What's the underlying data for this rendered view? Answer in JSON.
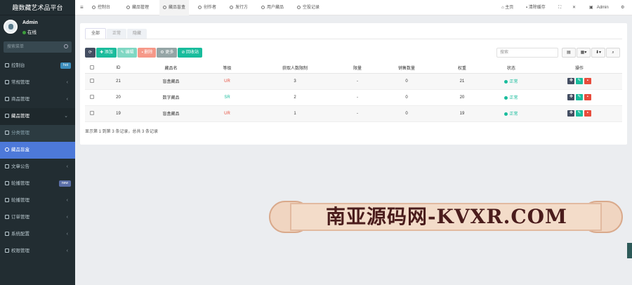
{
  "app": {
    "title": "趣数藏艺术品平台"
  },
  "user": {
    "name": "Admin",
    "status": "在线"
  },
  "sidebar": {
    "search_placeholder": "搜索菜单",
    "items": [
      {
        "label": "控制台",
        "badge": "hot",
        "badge_color": "#3c8dbc"
      },
      {
        "label": "常规管理"
      },
      {
        "label": "商品管理"
      },
      {
        "label": "藏品管理",
        "open": true
      },
      {
        "label": "文章公告"
      },
      {
        "label": "轮播管理",
        "badge": "new",
        "badge_color": "#5b6fa8"
      },
      {
        "label": "轮播管理"
      },
      {
        "label": "订单管理"
      },
      {
        "label": "系统配置"
      },
      {
        "label": "权限管理"
      }
    ],
    "sub_items": [
      {
        "label": "分类管理"
      },
      {
        "label": "藏品盲盒",
        "active": true
      }
    ]
  },
  "topbar": {
    "tabs": [
      "控制台",
      "藏品管理",
      "藏品盲盒",
      "创作者",
      "发行方",
      "用户藏品",
      "空投记录"
    ],
    "right": {
      "home": "主页",
      "clear_cache": "清除缓存",
      "user": "Admin"
    }
  },
  "content": {
    "tabs": [
      "全部",
      "正常",
      "隐藏"
    ],
    "buttons": {
      "add": "添加",
      "edit": "编辑",
      "delete": "删除",
      "more": "更多",
      "recycle": "回收站"
    },
    "search_placeholder": "搜索",
    "table": {
      "headers": [
        "ID",
        "藏品名",
        "等级",
        "获取人数限制",
        "限量",
        "销售数量",
        "权重",
        "状态",
        "操作"
      ],
      "rows": [
        {
          "id": "21",
          "name": "盲盒藏品",
          "level": "UR",
          "level_color": "#e74c3c",
          "limit": "3",
          "quota": "-",
          "sold": "0",
          "weight": "21",
          "status": "正常"
        },
        {
          "id": "20",
          "name": "数字藏品",
          "level": "SR",
          "level_color": "#18bc9c",
          "limit": "2",
          "quota": "-",
          "sold": "0",
          "weight": "20",
          "status": "正常"
        },
        {
          "id": "19",
          "name": "盲盒藏品",
          "level": "UR",
          "level_color": "#e74c3c",
          "limit": "1",
          "quota": "-",
          "sold": "0",
          "weight": "19",
          "status": "正常"
        }
      ]
    },
    "footer": "显示第 1 到第 3 条记录，总共 3 条记录"
  },
  "watermark": {
    "text": "南亚源码网-KVXR.COM"
  }
}
